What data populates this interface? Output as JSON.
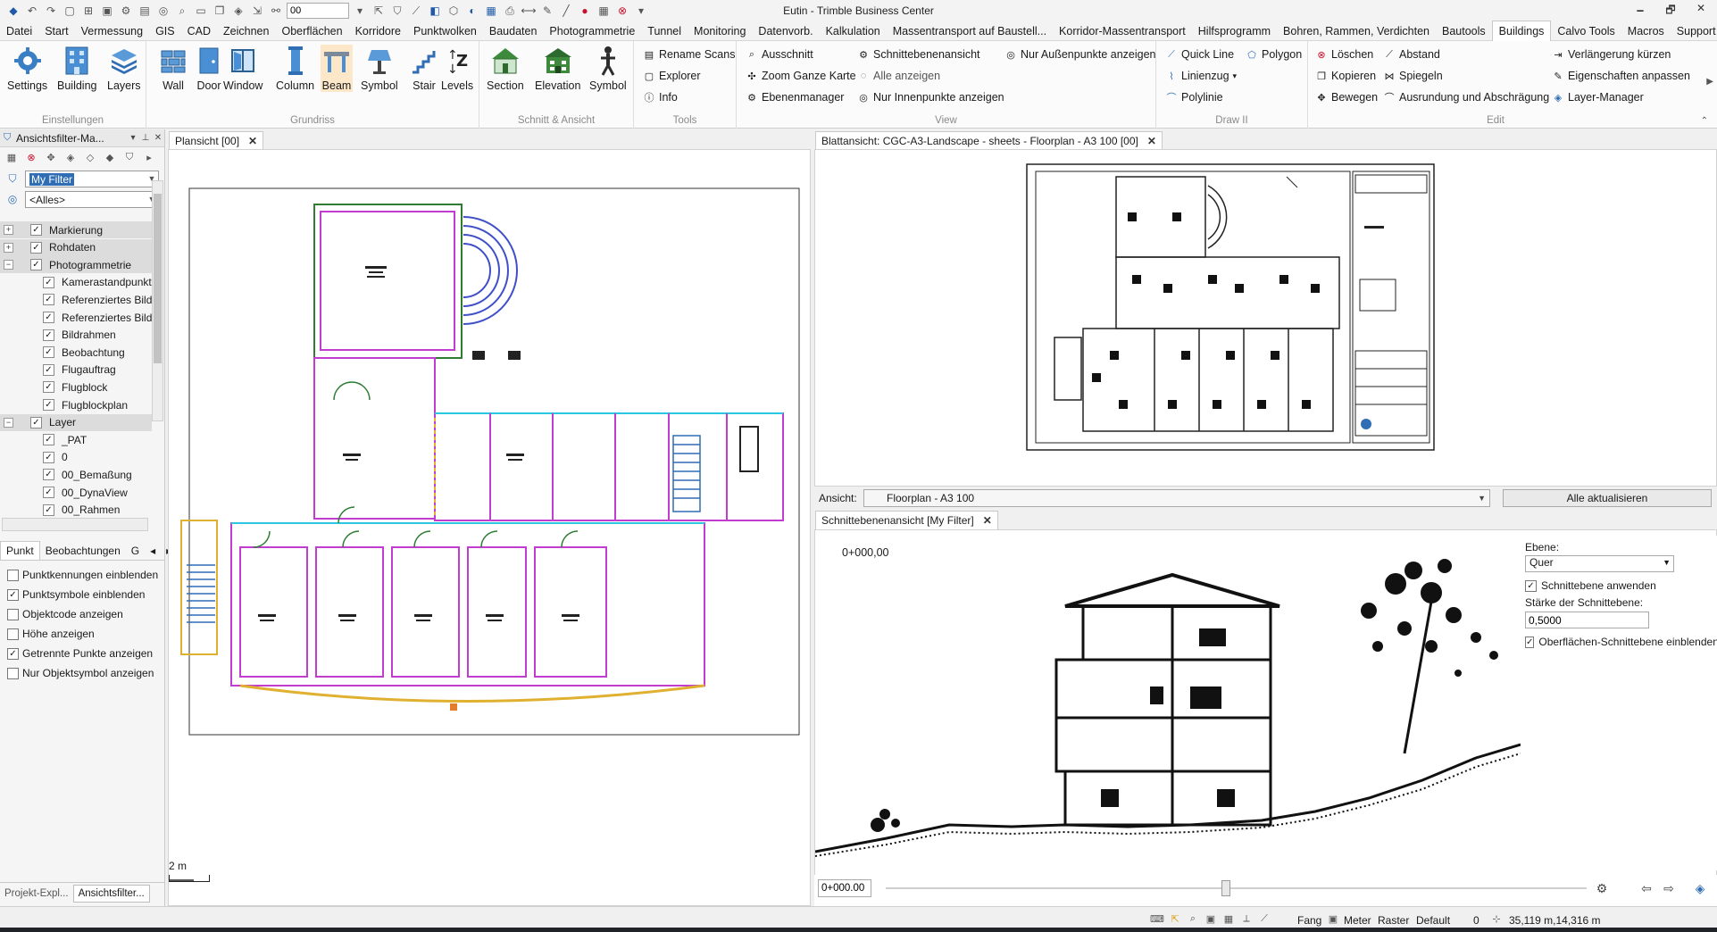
{
  "window": {
    "title": "Eutin - Trimble Business Center",
    "qat_layer_value": "00",
    "controls": {
      "minimize": "🗕",
      "restore": "🗗",
      "close": "✕"
    }
  },
  "menubar": {
    "items": [
      "Datei",
      "Start",
      "Vermessung",
      "GIS",
      "CAD",
      "Zeichnen",
      "Oberflächen",
      "Korridore",
      "Punktwolken",
      "Baudaten",
      "Photogrammetrie",
      "Tunnel",
      "Monitoring",
      "Datenvorb.",
      "Kalkulation",
      "Massentransport auf Baustell...",
      "Korridor-Massentransport",
      "Hilfsprogramm",
      "Bohren, Rammen, Verdichten",
      "Bautools",
      "Buildings",
      "Calvo Tools",
      "Macros",
      "Support"
    ],
    "active": "Buildings",
    "help": "?"
  },
  "ribbon": {
    "einstellungen": {
      "label": "Einstellungen",
      "buttons": [
        "Settings",
        "Building",
        "Layers"
      ]
    },
    "grundriss": {
      "label": "Grundriss",
      "buttons": [
        "Wall",
        "Door",
        "Window",
        "Column",
        "Beam",
        "Symbol",
        "Stair",
        "Levels"
      ]
    },
    "schnitt": {
      "label": "Schnitt & Ansicht",
      "buttons": [
        "Section",
        "Elevation",
        "Symbol"
      ]
    },
    "tools": {
      "label": "Tools",
      "buttons": [
        "Rename Scans",
        "Explorer",
        "Info"
      ]
    },
    "view": {
      "label": "View",
      "buttons": [
        "Ausschnitt",
        "Zoom Ganze Karte",
        "Ebenenmanager",
        "Schnittebenenansicht",
        "Alle anzeigen",
        "Nur Innenpunkte anzeigen",
        "Nur Außenpunkte anzeigen"
      ]
    },
    "draw": {
      "label": "Draw II",
      "buttons": [
        "Quick Line",
        "Polygon",
        "Linienzug",
        "Polylinie"
      ]
    },
    "edit": {
      "label": "Edit",
      "buttons": [
        "Löschen",
        "Abstand",
        "Kopieren",
        "Spiegeln",
        "Bewegen",
        "Ausrundung und Abschrägung",
        "Verlängerung kürzen",
        "Eigenschaften anpassen",
        "Layer-Manager"
      ]
    }
  },
  "leftpanel": {
    "title": "Ansichtsfilter-Ma...",
    "filter_value": "My Filter",
    "scope_value": "<Alles>",
    "tree": [
      {
        "label": "Markierung",
        "group": true,
        "expander": "+"
      },
      {
        "label": "Rohdaten",
        "group": true,
        "expander": "+"
      },
      {
        "label": "Photogrammetrie",
        "group": true,
        "expander": "−"
      },
      {
        "label": "Kamerastandpunkt",
        "group": false
      },
      {
        "label": "Referenziertes Bild",
        "group": false
      },
      {
        "label": "Referenziertes Bild",
        "group": false
      },
      {
        "label": "Bildrahmen",
        "group": false
      },
      {
        "label": "Beobachtung",
        "group": false
      },
      {
        "label": "Flugauftrag",
        "group": false
      },
      {
        "label": "Flugblock",
        "group": false
      },
      {
        "label": "Flugblockplan",
        "group": false
      },
      {
        "label": "Layer",
        "group": true,
        "expander": "−"
      },
      {
        "label": "_PAT",
        "group": false
      },
      {
        "label": "0",
        "group": false
      },
      {
        "label": "00_Bemaßung",
        "group": false
      },
      {
        "label": "00_DynaView",
        "group": false
      },
      {
        "label": "00_Rahmen",
        "group": false
      }
    ],
    "subtabs": [
      "Punkt",
      "Beobachtungen",
      "G"
    ],
    "options": [
      {
        "label": "Punktkennungen einblenden",
        "checked": false
      },
      {
        "label": "Punktsymbole einblenden",
        "checked": true
      },
      {
        "label": "Objektcode anzeigen",
        "checked": false
      },
      {
        "label": "Höhe anzeigen",
        "checked": false
      },
      {
        "label": "Getrennte Punkte anzeigen",
        "checked": true
      },
      {
        "label": "Nur Objektsymbol anzeigen",
        "checked": false
      }
    ],
    "bottom_tabs": [
      "Projekt-Expl...",
      "Ansichtsfilter..."
    ]
  },
  "plan": {
    "tab": "Plansicht [00]",
    "scale_label": "2 m"
  },
  "sheet": {
    "tab": "Blattansicht: CGC-A3-Landscape - sheets - Floorplan - A3 100 [00]",
    "ansicht_label": "Ansicht:",
    "ansicht_value": "Floorplan - A3 100",
    "refresh_label": "Alle aktualisieren"
  },
  "section": {
    "tab": "Schnittebenenansicht [My Filter]",
    "station_top": "0+000,00",
    "station_input": "0+000.00",
    "ebene_label": "Ebene:",
    "ebene_value": "Quer",
    "apply_label": "Schnittebene anwenden",
    "apply_checked": true,
    "thickness_label": "Stärke der Schnittebene:",
    "thickness_value": "0,5000",
    "surface_label": "Oberflächen-Schnittebene einblenden",
    "surface_checked": true
  },
  "statusbar": {
    "fang": "Fang",
    "meter": "Meter",
    "raster": "Raster",
    "default": "Default",
    "zero": "0",
    "coords": "35,119 m,14,316 m"
  }
}
